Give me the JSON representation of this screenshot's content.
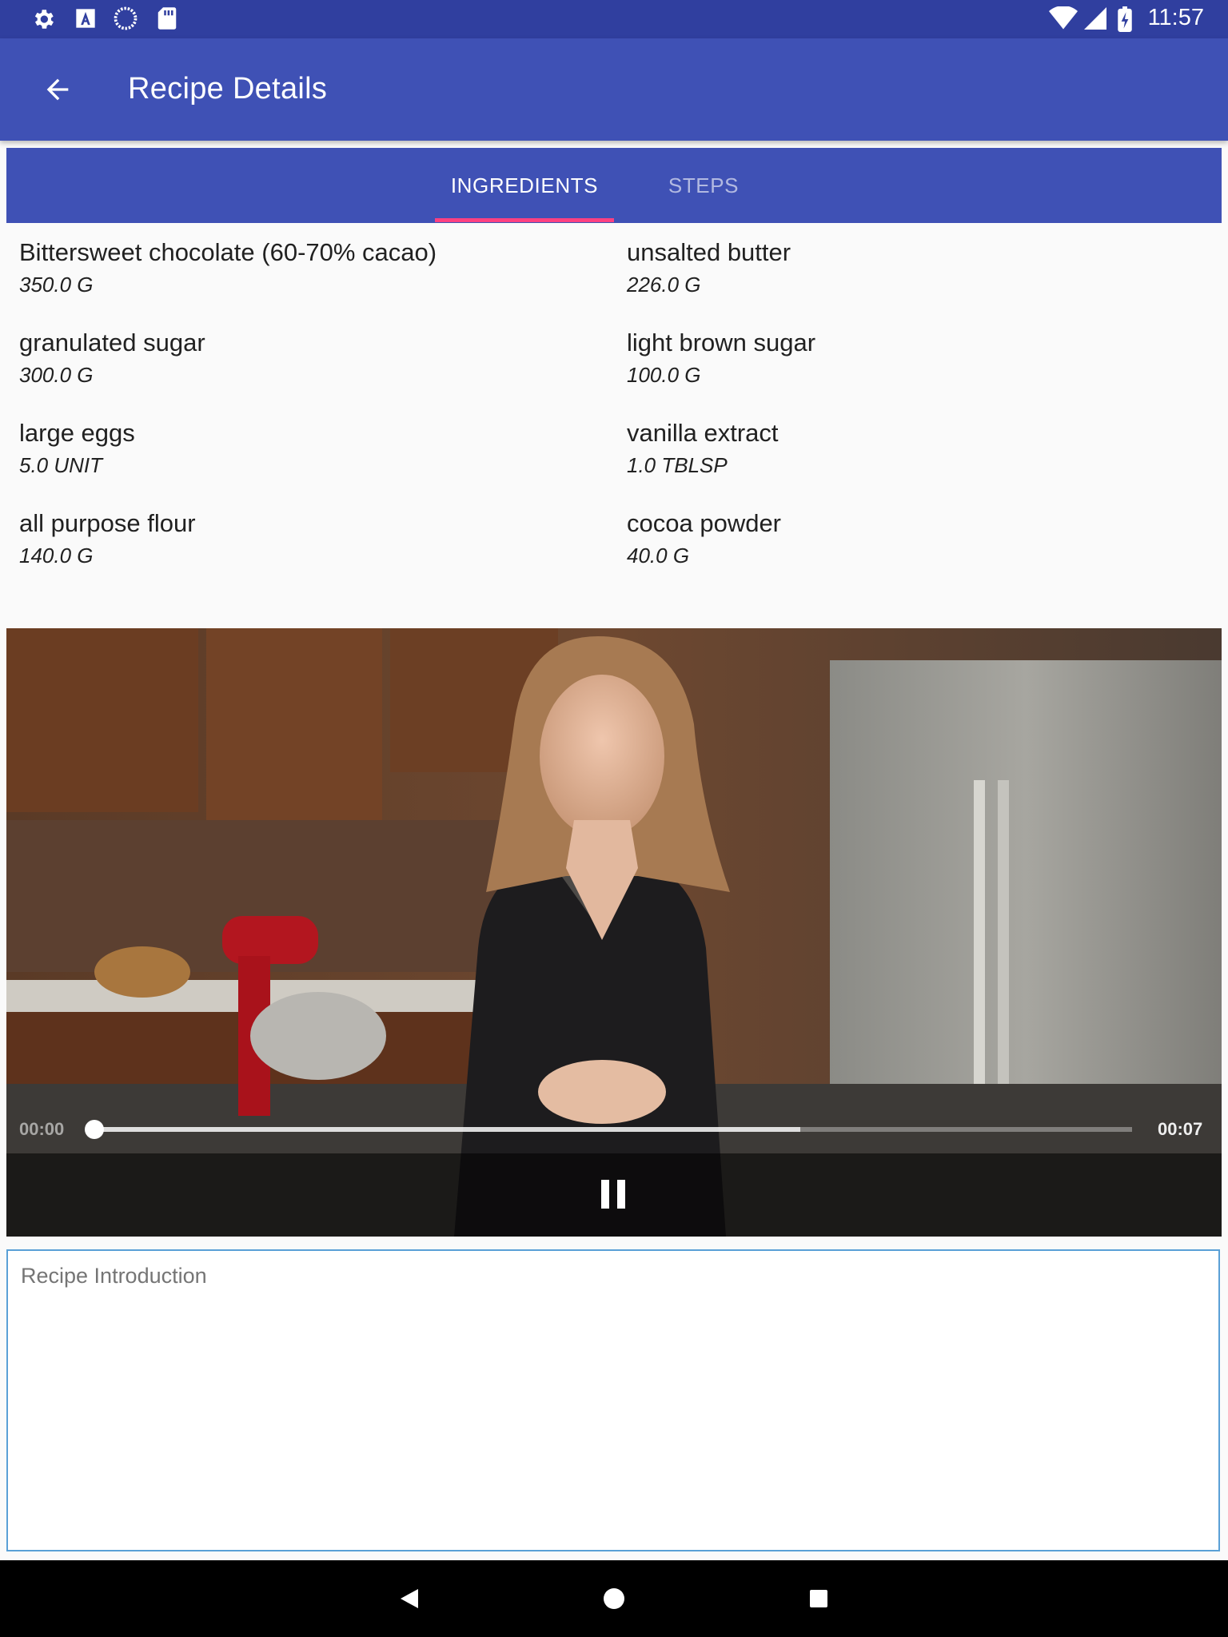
{
  "status_bar": {
    "time": "11:57",
    "left_icons": [
      "settings-icon",
      "text-a-icon",
      "loading-circle-icon",
      "sd-card-icon"
    ],
    "right_icons": [
      "wifi-icon",
      "cell-signal-icon",
      "battery-charging-icon"
    ]
  },
  "app_bar": {
    "title": "Recipe Details",
    "back_icon": "arrow-back-icon"
  },
  "tabs": [
    {
      "label": "INGREDIENTS",
      "selected": true
    },
    {
      "label": "STEPS",
      "selected": false
    }
  ],
  "ingredients": [
    {
      "name": "Bittersweet chocolate (60-70% cacao)",
      "quantity": "350.0 G"
    },
    {
      "name": "unsalted butter",
      "quantity": "226.0 G"
    },
    {
      "name": "granulated sugar",
      "quantity": "300.0 G"
    },
    {
      "name": "light brown sugar",
      "quantity": "100.0 G"
    },
    {
      "name": "large eggs",
      "quantity": "5.0 UNIT"
    },
    {
      "name": "vanilla extract",
      "quantity": "1.0 TBLSP"
    },
    {
      "name": "all purpose flour",
      "quantity": "140.0 G"
    },
    {
      "name": "cocoa powder",
      "quantity": "40.0 G"
    }
  ],
  "video": {
    "position": "00:00",
    "duration": "00:07",
    "played_fraction": 0.0,
    "buffered_fraction": 0.68,
    "control_icon": "pause-icon"
  },
  "description": {
    "text": "Recipe Introduction"
  },
  "nav_bar": {
    "icons": [
      "back-triangle-icon",
      "home-circle-icon",
      "recents-square-icon"
    ]
  },
  "colors": {
    "status_bar": "#303f9f",
    "primary": "#3f51b5",
    "accent": "#ff4081"
  }
}
